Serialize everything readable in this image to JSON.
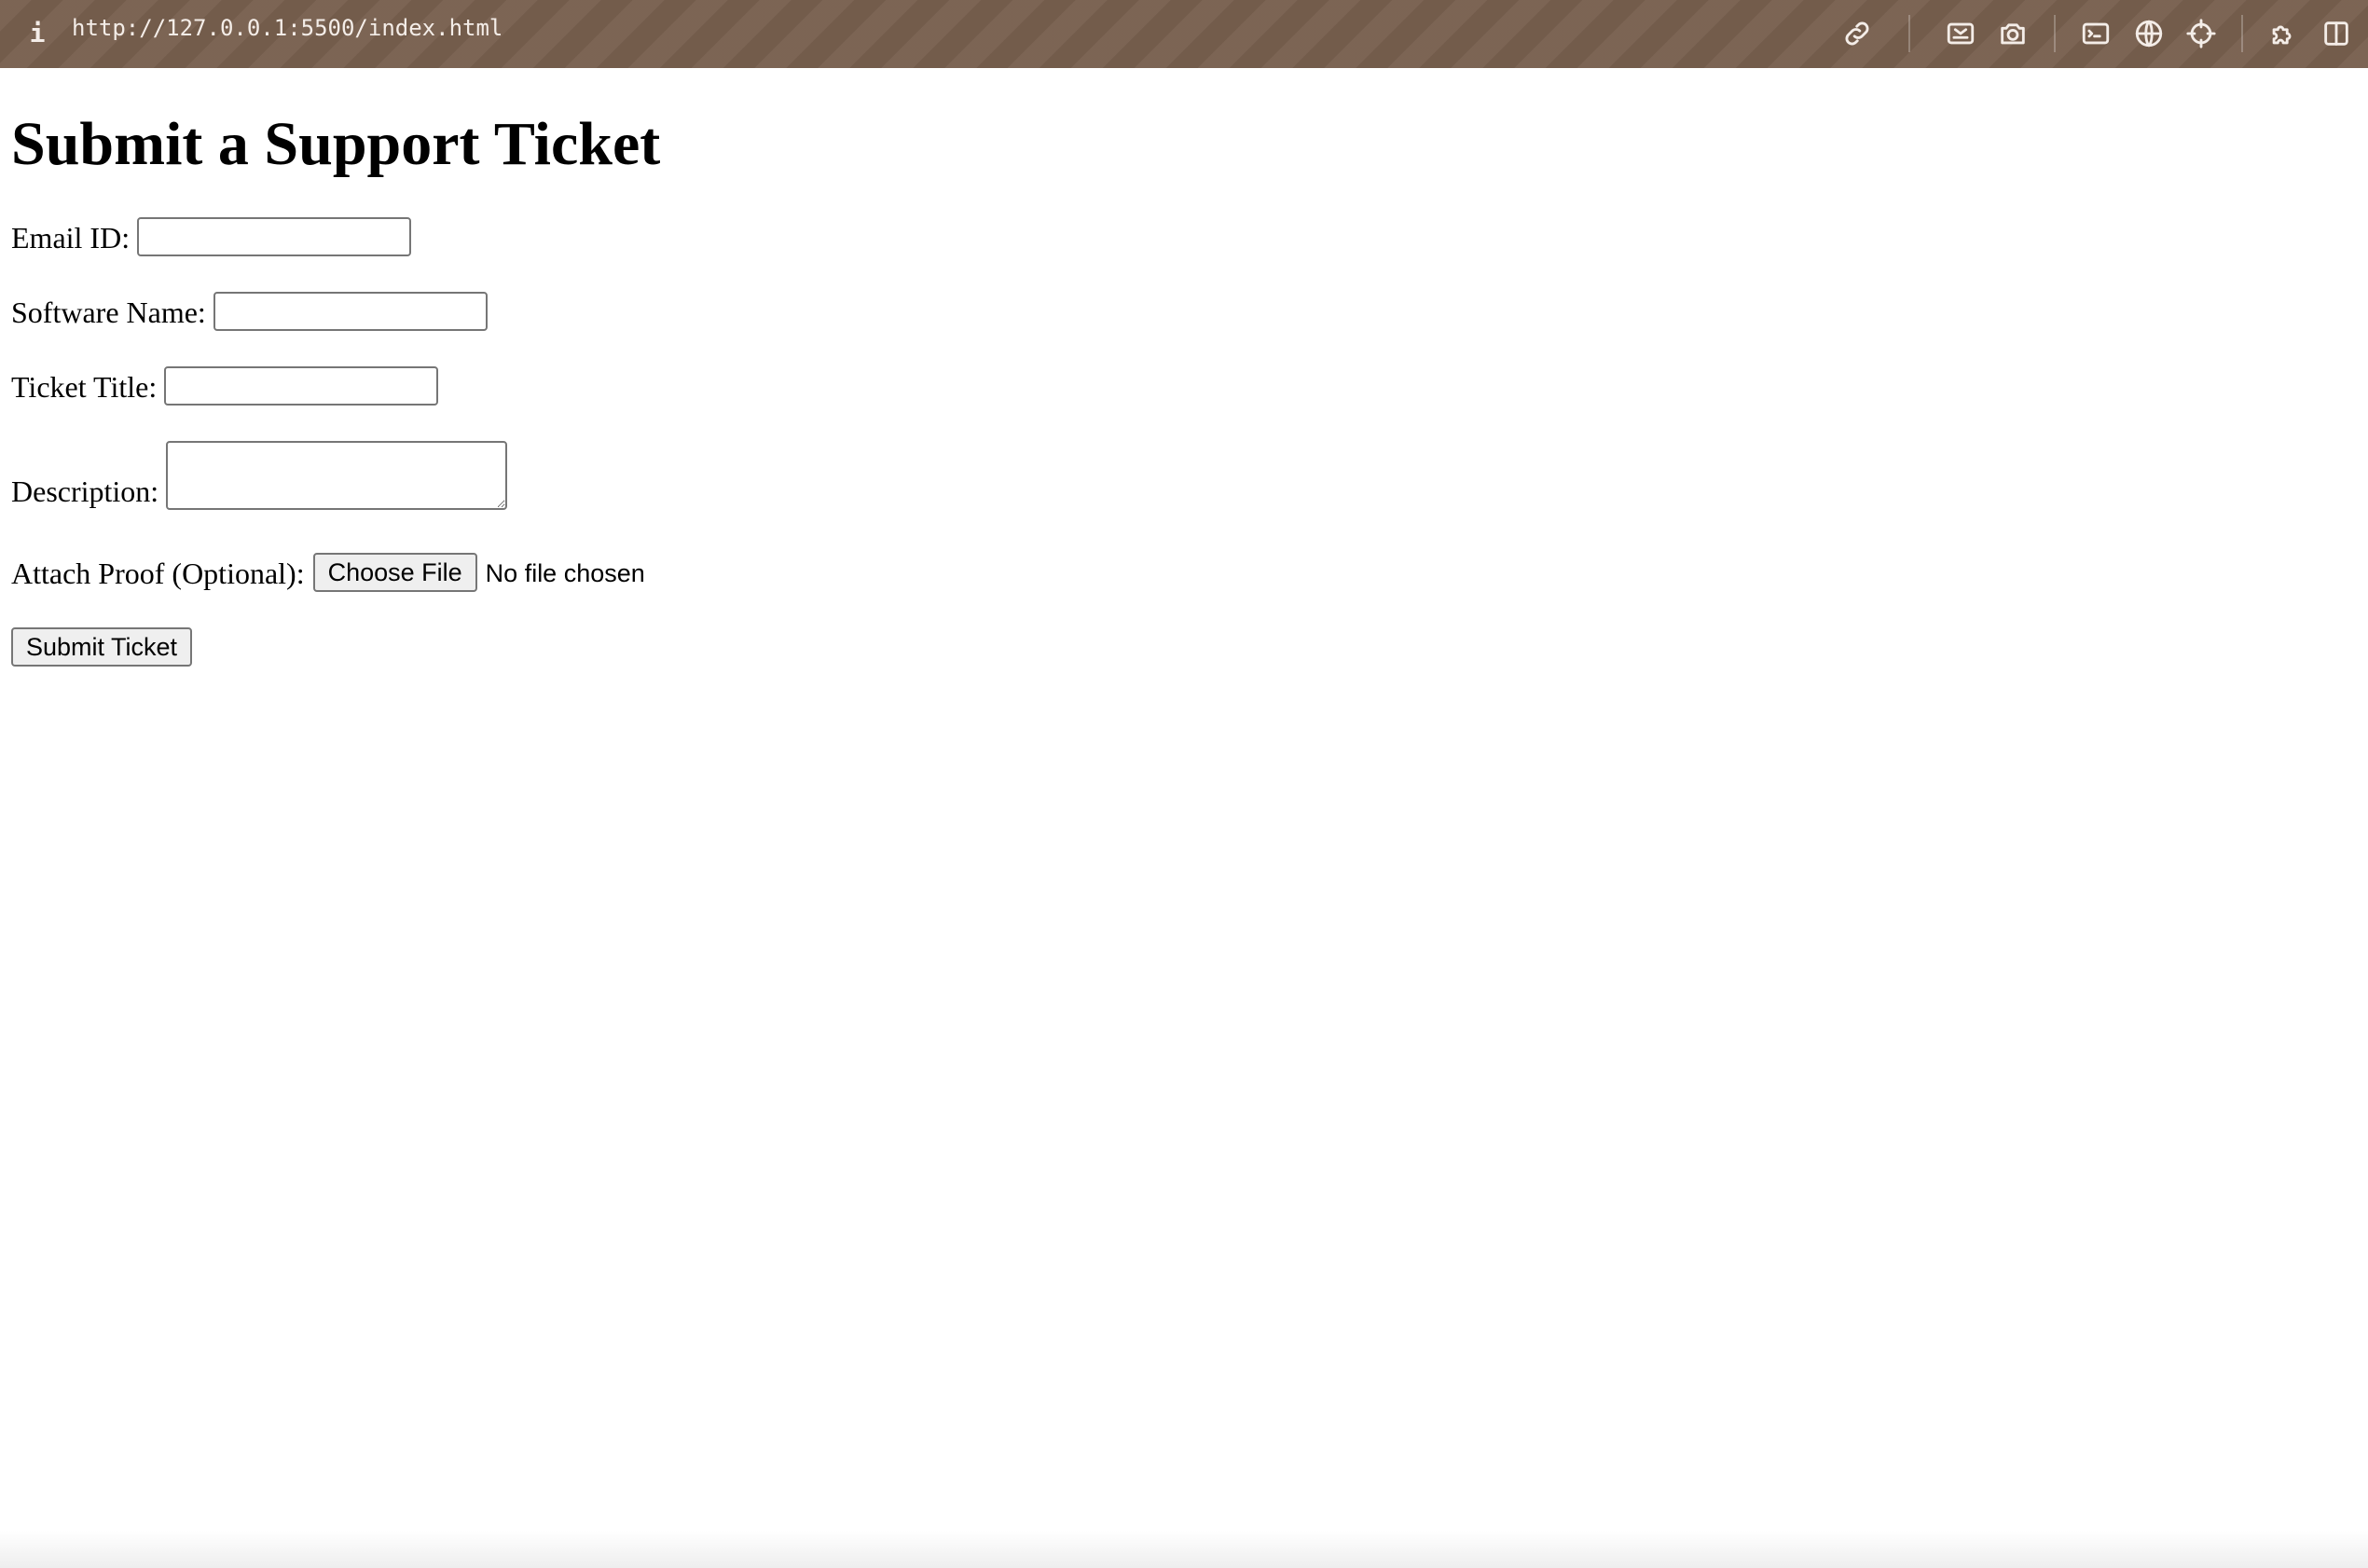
{
  "browser": {
    "url": "http://127.0.0.1:5500/index.html",
    "info_glyph": "i",
    "toolbar_icons": [
      "link-icon",
      "screenshot-area-icon",
      "camera-icon",
      "terminal-icon",
      "globe-icon",
      "crosshair-icon",
      "extensions-icon",
      "split-view-icon"
    ],
    "toolbar_color": "#775f4e"
  },
  "form": {
    "title": "Submit a Support Ticket",
    "email_label": "Email ID:",
    "email_value": "",
    "software_label": "Software Name:",
    "software_value": "",
    "ticket_title_label": "Ticket Title:",
    "ticket_title_value": "",
    "description_label": "Description:",
    "description_value": "",
    "attach_label": "Attach Proof (Optional):",
    "choose_file_label": "Choose File",
    "file_status": "No file chosen",
    "submit_label": "Submit Ticket"
  }
}
